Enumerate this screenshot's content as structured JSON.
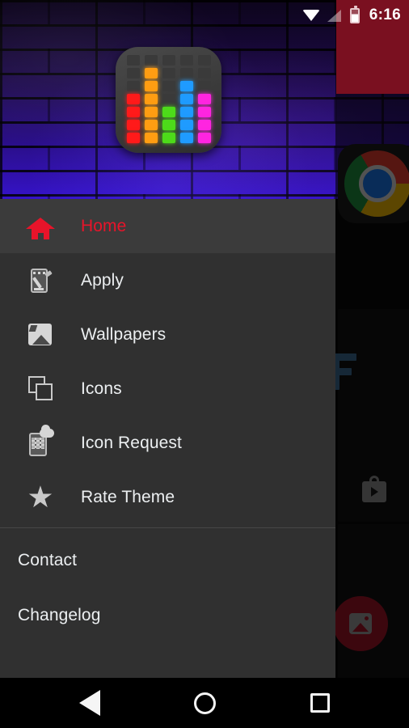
{
  "status_bar": {
    "time": "6:16",
    "icons": [
      "wifi-icon",
      "signal-icon",
      "battery-icon"
    ],
    "band_color": "#7a1020"
  },
  "drawer": {
    "header": {
      "app_icon": "equalizer-icon",
      "wallpaper": "purple-brick-wall"
    },
    "items": [
      {
        "label": "Home",
        "icon": "home-icon",
        "selected": true
      },
      {
        "label": "Apply",
        "icon": "apply-phone-icon",
        "selected": false
      },
      {
        "label": "Wallpapers",
        "icon": "image-icon",
        "selected": false
      },
      {
        "label": "Icons",
        "icon": "layers-icon",
        "selected": false
      },
      {
        "label": "Icon Request",
        "icon": "icon-request-icon",
        "selected": false
      },
      {
        "label": "Rate Theme",
        "icon": "star-icon",
        "selected": false
      }
    ],
    "secondary_items": [
      {
        "label": "Contact"
      },
      {
        "label": "Changelog"
      }
    ],
    "colors": {
      "background": "#303030",
      "selected_background": "#3b3b3b",
      "accent": "#e8142a",
      "label": "#eceff1",
      "divider": "#474747"
    }
  },
  "background_app": {
    "chrome_icon": "chrome-icon",
    "play_store_icon": "play-store-bag-icon",
    "fab": {
      "icon": "wallpaper-image-icon",
      "color": "#9e1427"
    }
  },
  "nav_bar": {
    "buttons": [
      {
        "name": "back",
        "icon": "back-triangle-icon"
      },
      {
        "name": "home",
        "icon": "home-circle-icon"
      },
      {
        "name": "recents",
        "icon": "recents-square-icon"
      }
    ]
  },
  "equalizer": {
    "columns": [
      {
        "color": "#ff1a1a",
        "lit": 4
      },
      {
        "color": "#ff9d12",
        "lit": 6
      },
      {
        "color": "#4ddb1a",
        "lit": 3
      },
      {
        "color": "#1f9bff",
        "lit": 5
      },
      {
        "color": "#ff25e0",
        "lit": 4
      }
    ],
    "rows": 7,
    "off_color": "#3a3a3a"
  }
}
